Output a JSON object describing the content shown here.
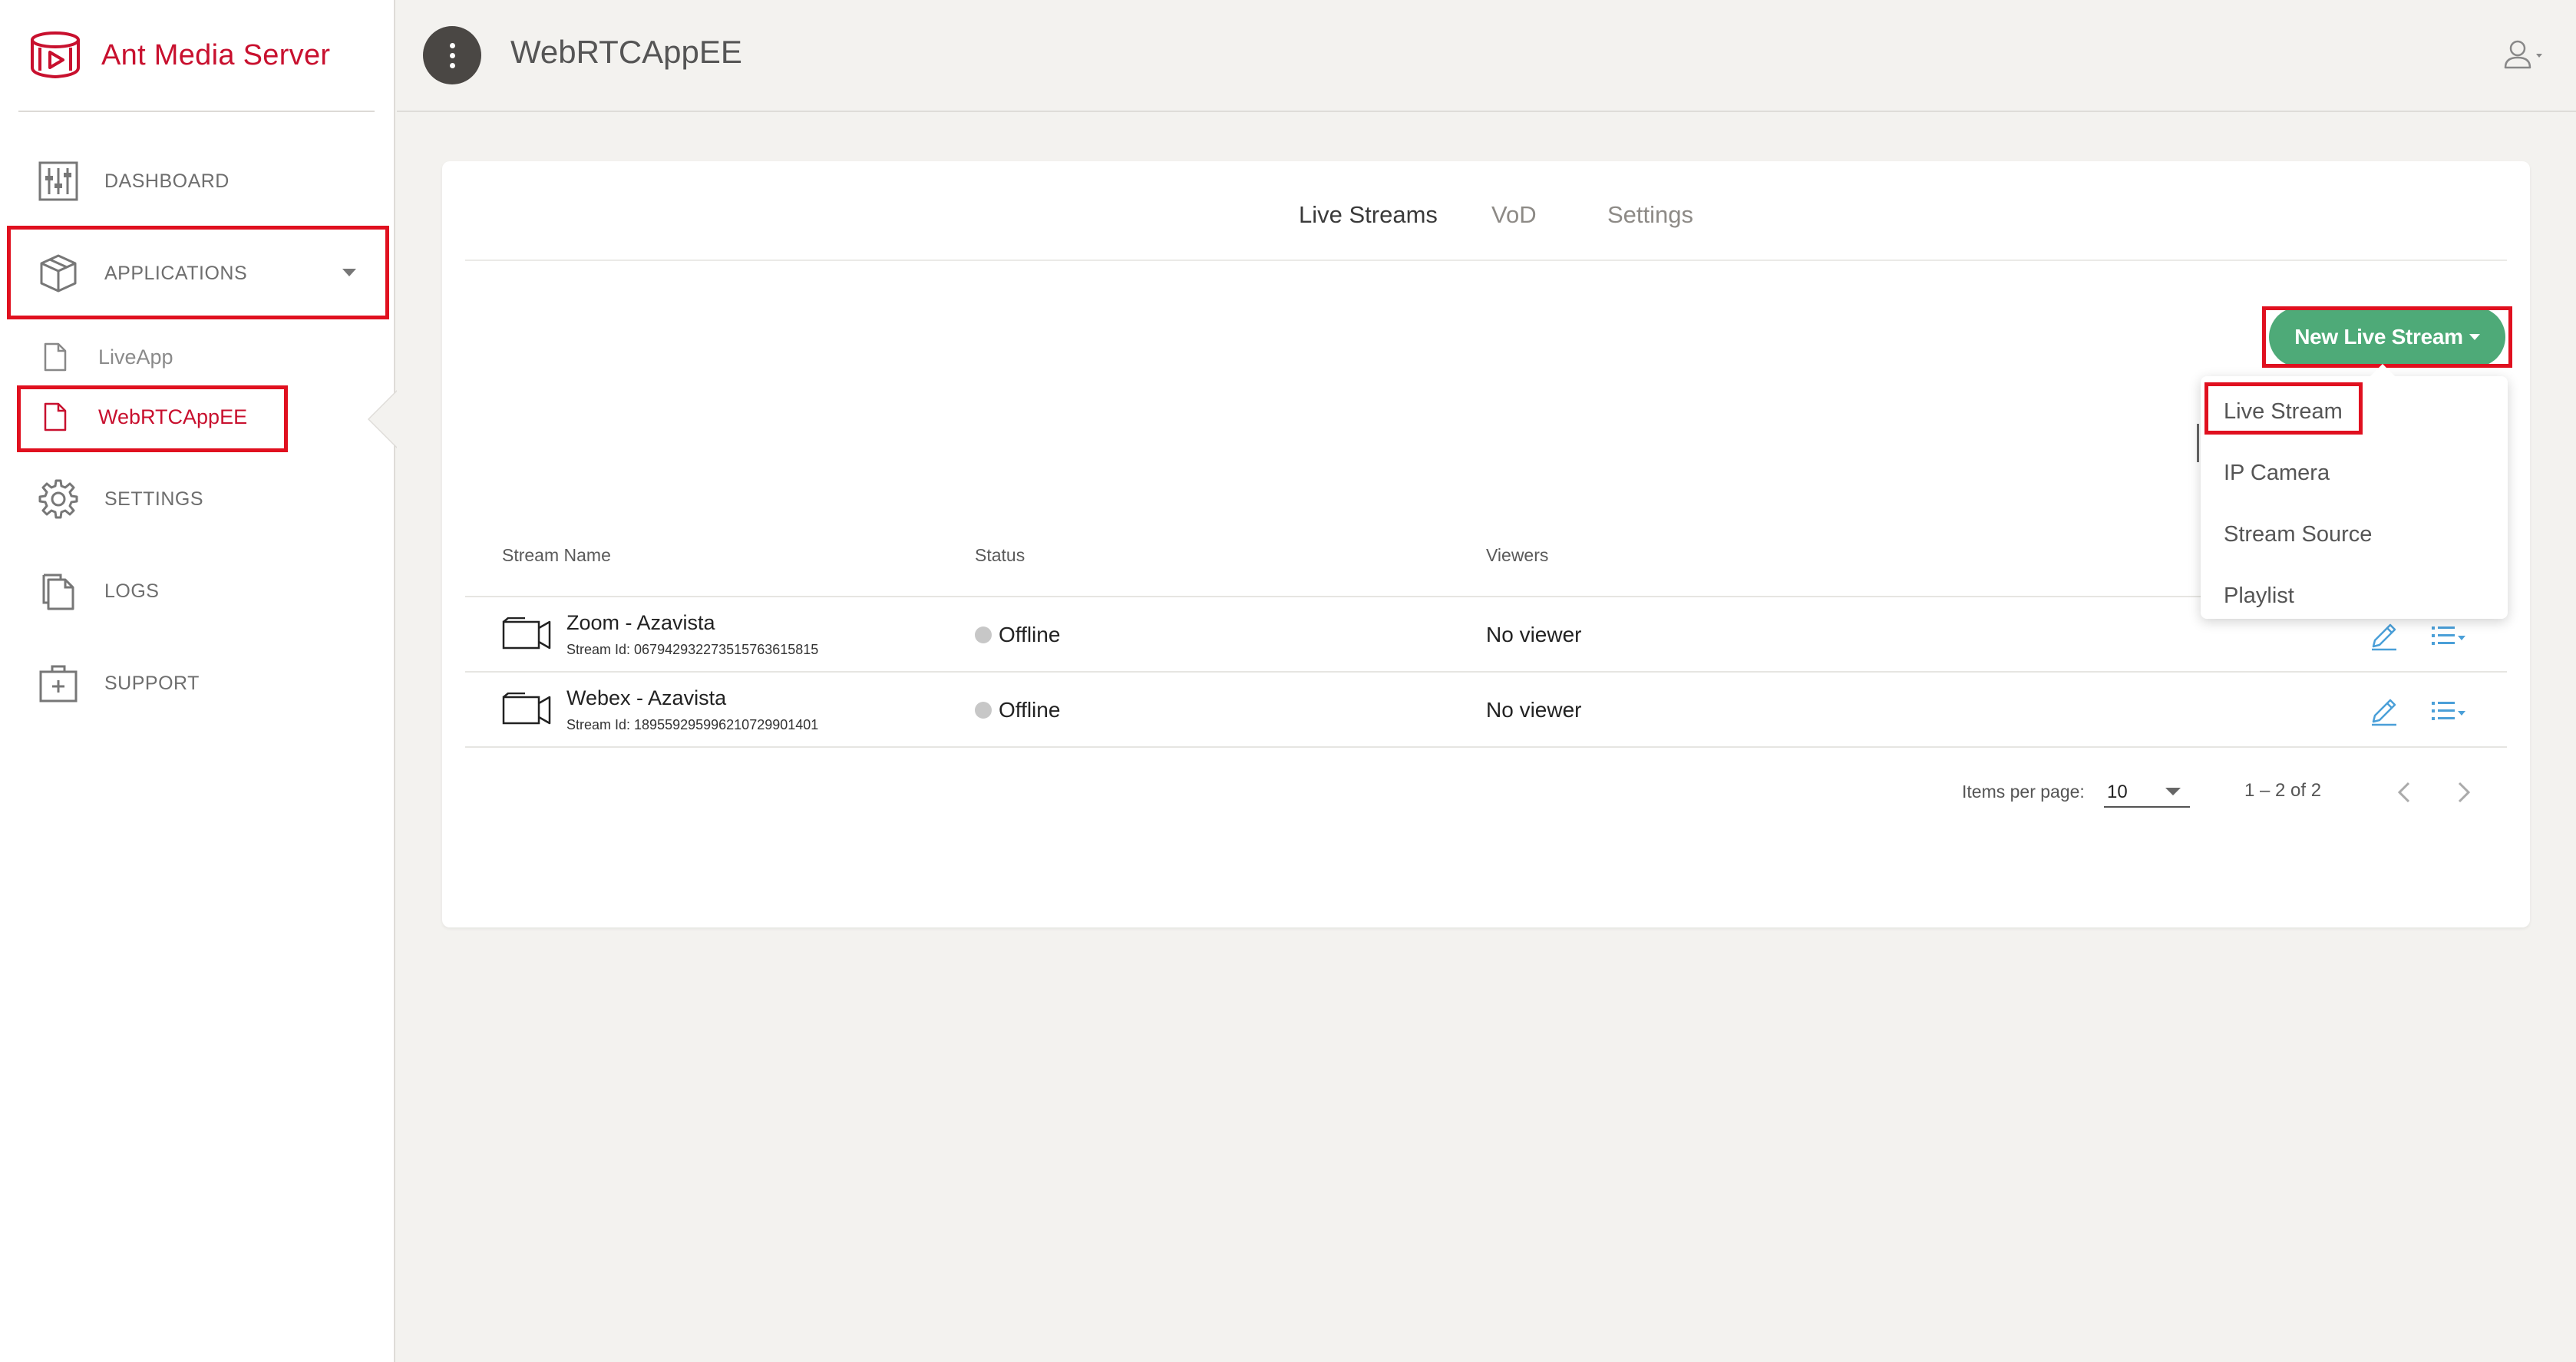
{
  "brand": {
    "name": "Ant Media Server",
    "color": "#c8102e",
    "icon": "ant-media-logo-icon"
  },
  "sidebar": {
    "items": [
      {
        "label": "DASHBOARD",
        "icon": "sliders-icon"
      },
      {
        "label": "APPLICATIONS",
        "icon": "box-icon"
      },
      {
        "label": "SETTINGS",
        "icon": "gear-icon"
      },
      {
        "label": "LOGS",
        "icon": "files-icon"
      },
      {
        "label": "SUPPORT",
        "icon": "medical-kit-icon"
      }
    ],
    "applications": [
      {
        "label": "LiveApp",
        "icon": "file-icon"
      },
      {
        "label": "WebRTCAppEE",
        "icon": "file-icon",
        "active": true
      }
    ]
  },
  "header": {
    "title": "WebRTCAppEE"
  },
  "tabs": [
    {
      "label": "Live Streams",
      "active": true
    },
    {
      "label": "VoD"
    },
    {
      "label": "Settings"
    }
  ],
  "new_stream": {
    "label": "New Live Stream",
    "color": "#4eaa78",
    "menu": [
      "Live Stream",
      "IP Camera",
      "Stream Source",
      "Playlist"
    ]
  },
  "table": {
    "columns": [
      "Stream Name",
      "Status",
      "Viewers"
    ],
    "rows": [
      {
        "name": "Zoom - Azavista",
        "stream_id": "Stream Id: 067942932273515763615815",
        "status": "Offline",
        "viewers": "No viewer"
      },
      {
        "name": "Webex - Azavista",
        "stream_id": "Stream Id: 189559295996210729901401",
        "status": "Offline",
        "viewers": "No viewer"
      }
    ]
  },
  "pagination": {
    "label": "Items per page:",
    "per_page": "10",
    "range": "1 – 2 of 2"
  },
  "highlight_color": "#e0101f"
}
